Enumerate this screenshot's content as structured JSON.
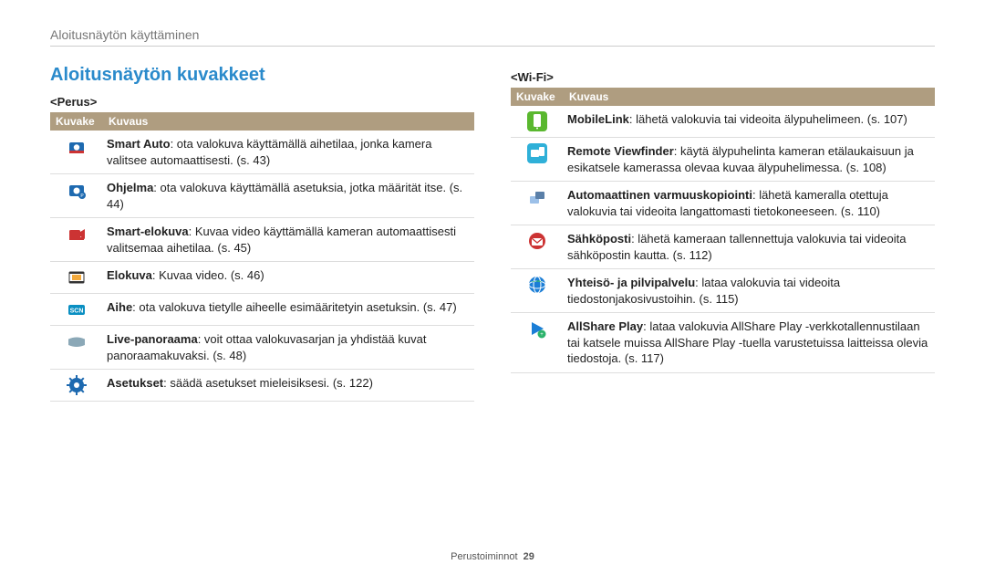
{
  "header": {
    "breadcrumb": "Aloitusnäytön käyttäminen"
  },
  "section_title": "Aloitusnäytön kuvakkeet",
  "perus": {
    "label": "<Perus>",
    "cols": {
      "icon": "Kuvake",
      "desc": "Kuvaus"
    },
    "rows": [
      {
        "icon": "smart-auto-icon",
        "term": "Smart Auto",
        "sep": ": ",
        "rest": "ota valokuva käyttämällä aihetilaa, jonka kamera valitsee automaattisesti. (s. 43)"
      },
      {
        "icon": "program-icon",
        "term": "Ohjelma",
        "sep": ": ",
        "rest": "ota valokuva käyttämällä asetuksia, jotka määrität itse. (s. 44)"
      },
      {
        "icon": "smart-movie-icon",
        "term": "Smart-elokuva",
        "sep": ": ",
        "rest": "Kuvaa video käyttämällä kameran automaattisesti valitsemaa aihetilaa. (s. 45)"
      },
      {
        "icon": "movie-icon",
        "term": "Elokuva",
        "sep": ": ",
        "rest": "Kuvaa video. (s. 46)"
      },
      {
        "icon": "scene-icon",
        "term": "Aihe",
        "sep": ": ",
        "rest": "ota valokuva tietylle aiheelle esimääritetyin asetuksin. (s. 47)"
      },
      {
        "icon": "live-panorama-icon",
        "term": "Live-panoraama",
        "sep": ": ",
        "rest": "voit ottaa valokuvasarjan ja yhdistää kuvat panoraamakuvaksi. (s. 48)"
      },
      {
        "icon": "settings-icon",
        "term": "Asetukset",
        "sep": ": ",
        "rest": "säädä asetukset mieleisiksesi. (s. 122)"
      }
    ]
  },
  "wifi": {
    "label": "<Wi-Fi>",
    "cols": {
      "icon": "Kuvake",
      "desc": "Kuvaus"
    },
    "rows": [
      {
        "icon": "mobilelink-icon",
        "term": "MobileLink",
        "sep": ": ",
        "rest": "lähetä valokuvia tai videoita älypuhelimeen. (s. 107)"
      },
      {
        "icon": "remote-viewfinder-icon",
        "term": "Remote Viewfinder",
        "sep": ": ",
        "rest": "käytä älypuhelinta kameran etälaukaisuun ja esikatsele kamerassa olevaa kuvaa älypuhelimessa. (s. 108)"
      },
      {
        "icon": "auto-backup-icon",
        "term": "Automaattinen varmuuskopiointi",
        "sep": ": ",
        "rest": "lähetä kameralla otettuja valokuvia tai videoita langattomasti tietokoneeseen. (s. 110)"
      },
      {
        "icon": "email-icon",
        "term": "Sähköposti",
        "sep": ": ",
        "rest": "lähetä kameraan tallennettuja valokuvia tai videoita sähköpostin kautta. (s. 112)"
      },
      {
        "icon": "cloud-icon",
        "term": "Yhteisö- ja pilvipalvelu",
        "sep": ": ",
        "rest": "lataa valokuvia tai videoita tiedostonjakosivustoihin. (s. 115)"
      },
      {
        "icon": "allshare-icon",
        "term": "AllShare Play",
        "sep": ": ",
        "rest": "lataa valokuvia AllShare Play -verkkotallennustilaan tai katsele muissa AllShare Play -tuella varustetuissa laitteissa olevia tiedostoja. (s. 117)"
      }
    ]
  },
  "footer": {
    "section": "Perustoiminnot",
    "page": "29"
  },
  "icons": {
    "smart-auto-icon": {
      "bg": "#fff",
      "fg": "#1e6ab0",
      "accent": "#c33",
      "type": "camera"
    },
    "program-icon": {
      "bg": "#fff",
      "fg": "#1e6ab0",
      "accent": "#1e6ab0",
      "type": "camera-p"
    },
    "smart-movie-icon": {
      "bg": "#fff",
      "fg": "#c33",
      "accent": "#c33",
      "type": "movie-smart"
    },
    "movie-icon": {
      "bg": "#fff",
      "fg": "#333",
      "accent": "#333",
      "type": "film"
    },
    "scene-icon": {
      "bg": "#fff",
      "fg": "#0a8fc2",
      "accent": "#0a8fc2",
      "type": "scn"
    },
    "live-panorama-icon": {
      "bg": "#fff",
      "fg": "#79a",
      "accent": "#79a",
      "type": "pano"
    },
    "settings-icon": {
      "bg": "#fff",
      "fg": "#1e6ab0",
      "accent": "#1e6ab0",
      "type": "gear"
    },
    "mobilelink-icon": {
      "bg": "#5ab82f",
      "fg": "#fff",
      "type": "phone"
    },
    "remote-viewfinder-icon": {
      "bg": "#2fb0d8",
      "fg": "#fff",
      "type": "viewfinder"
    },
    "auto-backup-icon": {
      "bg": "#fff",
      "fg": "#557",
      "type": "backup"
    },
    "email-icon": {
      "bg": "#fff",
      "fg": "#c33",
      "type": "mail"
    },
    "cloud-icon": {
      "bg": "#fff",
      "fg": "#1b7ed6",
      "type": "globe"
    },
    "allshare-icon": {
      "bg": "#fff",
      "fg": "#1b7ed6",
      "accent": "#2bb36b",
      "type": "play"
    }
  }
}
